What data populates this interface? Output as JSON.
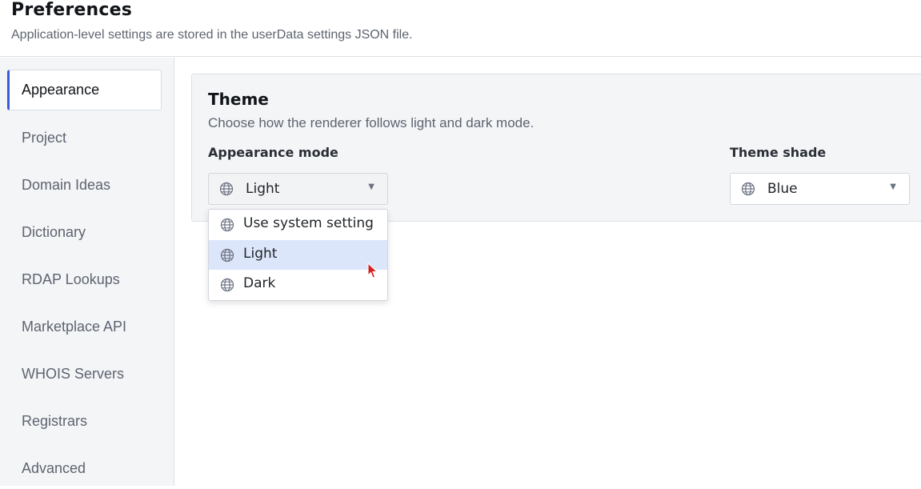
{
  "header": {
    "title": "Preferences",
    "subtitle": "Application-level settings are stored in the userData settings JSON file."
  },
  "sidebar": {
    "items": [
      {
        "label": "Appearance",
        "active": true
      },
      {
        "label": "Project"
      },
      {
        "label": "Domain Ideas"
      },
      {
        "label": "Dictionary"
      },
      {
        "label": "RDAP Lookups"
      },
      {
        "label": "Marketplace API"
      },
      {
        "label": "WHOIS Servers"
      },
      {
        "label": "Registrars"
      },
      {
        "label": "Advanced"
      }
    ]
  },
  "theme": {
    "title": "Theme",
    "description": "Choose how the renderer follows light and dark mode.",
    "appearance_mode": {
      "label": "Appearance mode",
      "value": "Light",
      "icon": "globe-icon",
      "options": [
        "Use system setting",
        "Light",
        "Dark"
      ],
      "highlighted": "Light"
    },
    "theme_shade": {
      "label": "Theme shade",
      "value": "Blue",
      "icon": "globe-icon"
    }
  },
  "colors": {
    "accent": "#3b5bdb",
    "highlight": "#dce6fa",
    "cursor": "#d62020"
  }
}
